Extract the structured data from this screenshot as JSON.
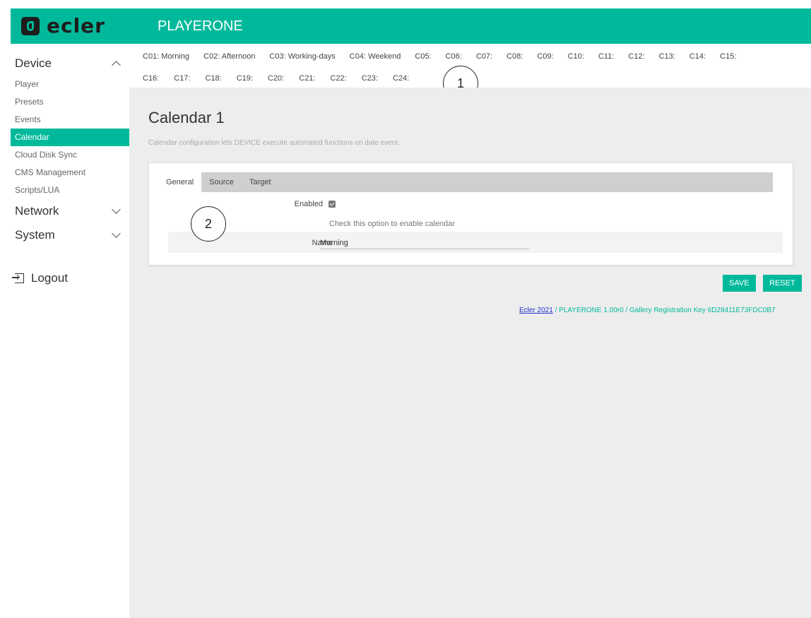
{
  "header": {
    "logo_text": "ecler",
    "app_title": "PLAYERONE"
  },
  "sidebar": {
    "device_label": "Device",
    "device_items": [
      "Player",
      "Presets",
      "Events",
      "Calendar",
      "Cloud Disk Sync",
      "CMS Management",
      "Scripts/LUA"
    ],
    "active_item": "Calendar",
    "network_label": "Network",
    "system_label": "System",
    "logout_label": "Logout"
  },
  "calendars": {
    "row1": [
      "C01: Morning",
      "C02: Afternoon",
      "C03: Working-days",
      "C04: Weekend",
      "C05:",
      "C06:",
      "C07:",
      "C08:",
      "C09:",
      "C10:",
      "C11:",
      "C12:",
      "C13:",
      "C14:",
      "C15:"
    ],
    "row2": [
      "C16:",
      "C17:",
      "C18:",
      "C19:",
      "C20:",
      "C21:",
      "C22:",
      "C23:",
      "C24:"
    ]
  },
  "callouts": [
    "1",
    "2"
  ],
  "page": {
    "title": "Calendar 1",
    "description": "Calendar configuration lets DEVICE execute automated functions on date event."
  },
  "tabs": [
    "General",
    "Source",
    "Target"
  ],
  "form": {
    "enabled_label": "Enabled",
    "enabled_checked": true,
    "enabled_hint": "Check this option to enable calendar",
    "name_label": "Name",
    "name_value": "Morning"
  },
  "buttons": {
    "save": "SAVE",
    "reset": "RESET"
  },
  "footer": {
    "link": "Ecler 2021",
    "text": " / PLAYERONE 1.00r0 / Gallery Registration Key 6D28411E73FDC0B7"
  },
  "colors": {
    "accent": "#00b99b",
    "main_bg": "#ededed"
  }
}
